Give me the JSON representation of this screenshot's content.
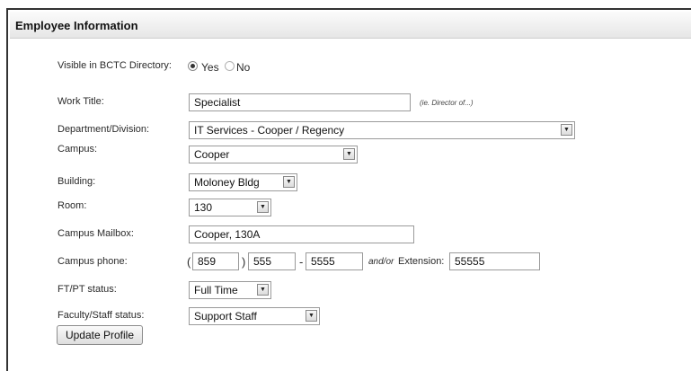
{
  "panel": {
    "title": "Employee Information"
  },
  "directory": {
    "label": "Visible in BCTC Directory:",
    "yes_label": "Yes",
    "no_label": "No",
    "selected": "Yes"
  },
  "work_title": {
    "label": "Work Title:",
    "value": "Specialist",
    "hint": "(ie. Director of...)"
  },
  "department": {
    "label": "Department/Division:",
    "value": "IT Services - Cooper / Regency"
  },
  "campus": {
    "label": "Campus:",
    "value": "Cooper"
  },
  "building": {
    "label": "Building:",
    "value": "Moloney Bldg"
  },
  "room": {
    "label": "Room:",
    "value": "130"
  },
  "mailbox": {
    "label": "Campus Mailbox:",
    "value": "Cooper, 130A"
  },
  "phone": {
    "label": "Campus phone:",
    "open_paren": "(",
    "area_code": "859",
    "close_paren": ")",
    "prefix": "555",
    "dash": "-",
    "line": "5555",
    "andor": "and/or",
    "extension_label": "Extension:",
    "extension": "55555"
  },
  "ftpt": {
    "label": "FT/PT status:",
    "value": "Full Time"
  },
  "faculty_staff": {
    "label": "Faculty/Staff status:",
    "value": "Support Staff"
  },
  "actions": {
    "update_label": "Update Profile"
  },
  "icons": {
    "dropdown": "chevron-down-icon",
    "radio": "radio-button"
  }
}
